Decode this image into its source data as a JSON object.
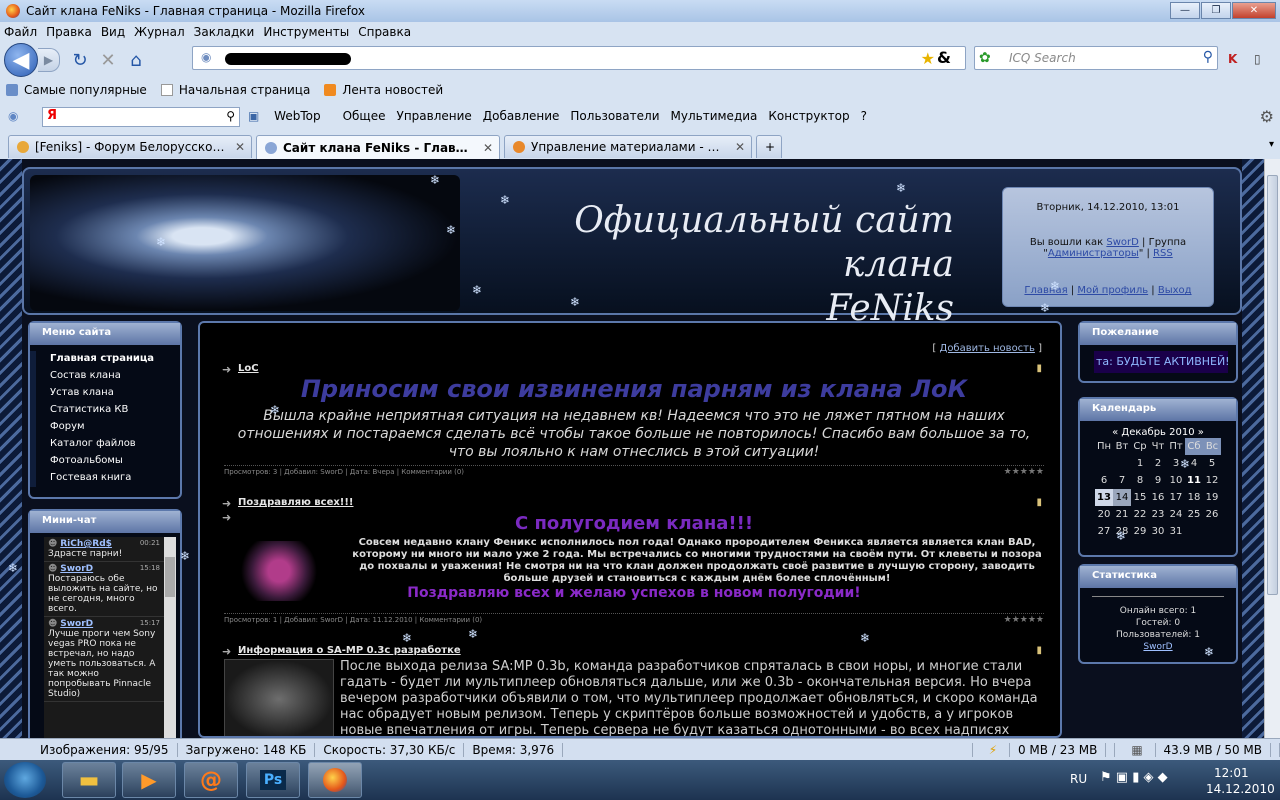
{
  "window": {
    "title": "Сайт клана FeNiks - Главная страница - Mozilla Firefox"
  },
  "menubar": [
    "Файл",
    "Правка",
    "Вид",
    "Журнал",
    "Закладки",
    "Инструменты",
    "Справка"
  ],
  "icq_search": {
    "placeholder": "ICQ Search"
  },
  "bookmarks": [
    "Самые популярные",
    "Начальная страница",
    "Лента новостей"
  ],
  "yandex": {
    "logo": "Я",
    "webtop": "WebTop",
    "menu": [
      "Общее",
      "Управление",
      "Добавление",
      "Пользователи",
      "Мультимедиа",
      "Конструктор",
      "?"
    ]
  },
  "tabs": [
    {
      "label": "[Feniks] - Форум Белорусского Иг..."
    },
    {
      "label": "Сайт клана FeNiks - Главная стра..."
    },
    {
      "label": "Управление материалами - Ново..."
    }
  ],
  "site": {
    "title_line1": "Официальный сайт клана",
    "title_line2": "FeNiks",
    "datetime": "Вторник, 14.12.2010, 13:01",
    "logged_in_prefix": "Вы вошли как",
    "username": "SworD",
    "group_prefix": "Группа",
    "group": "Администраторы",
    "rss": "RSS",
    "nav": [
      "Главная",
      "Мой профиль",
      "Выход"
    ],
    "site_menu_title": "Меню сайта",
    "site_menu": [
      "Главная страница",
      "Состав клана",
      "Устав клана",
      "Статистика КВ",
      "Форум",
      "Каталог файлов",
      "Фотоальбомы",
      "Гостевая книга"
    ],
    "minichat_title": "Мини-чат",
    "minichat": [
      {
        "name": "RiCh@Rd$",
        "time": "00:21",
        "text": "Здрасте парни!"
      },
      {
        "name": "SworD",
        "time": "15:18",
        "text": "Постараюсь обе выложить на сайте, но не сегодня, много всего."
      },
      {
        "name": "SworD",
        "time": "15:17",
        "text": "Лучше проги чем Sony vegas PRO пока не встречал, но надо уметь пользоваться. А так можно попробывать Pinnacle Studio)"
      }
    ],
    "add_news": "Добавить новость",
    "news": [
      {
        "title": "LoC",
        "headline": "Приносим свои извинения парням из клана ЛоК",
        "body": "Вышла крайне неприятная ситуация на недавнем кв! Надеемся что это не ляжет пятном на наших отношениях и постараемся сделать всё чтобы такое больше не повторилось! Спасибо вам большое за то, что вы лояльно к нам отнеслись в этой ситуации!",
        "meta": "Просмотров: 3 | Добавил: SworD | Дата: Вчера | Комментарии (0)"
      },
      {
        "title": "Поздравляю всех!!!",
        "headline": "С полугодием клана!!!",
        "body": "Совсем недавно клану Феникс исполнилось пол года! Однако прородителем Феникса является является клан BAD, которому ни много ни мало уже 2 года. Мы встречались со многими трудностями на своём пути. От клеветы и позора до похвалы и уважения! Не смотря ни на что клан должен продолжать своё развитие в лучшую сторону, заводить больше друзей и становиться с каждым днём более сплочённым!",
        "footer": "Поздравляю всех и желаю успехов в новом полугодии!",
        "meta": "Просмотров: 1 | Добавил: SworD | Дата: 11.12.2010 | Комментарии (0)"
      },
      {
        "title": "Информация о SA-MP 0.3c разработке",
        "body": "После выхода релиза SA:MP 0.3b, команда разработчиков спряталась в свои норы, и многие стали гадать - будет ли мультиплеер обновляться дальше, или же 0.3b - окончательная версия. Но вчера вечером разработчики объявили о том, что мультиплеер продолжает обновляться, и скоро команда нас обрадует новым релизом. Теперь у скриптёров больше возможностей и удобств, а у игроков новые впечатления от игры. Теперь сервера не будут казаться однотонными - во всех надписях"
      }
    ],
    "wish_title": "Пожелание",
    "wish_text": "та: БУДЬТЕ АКТИВНЕЙ!!",
    "calendar_title": "Календарь",
    "calendar_month": "« Декабрь 2010 »",
    "calendar_days": [
      "Пн",
      "Вт",
      "Ср",
      "Чт",
      "Пт",
      "Сб",
      "Вс"
    ],
    "calendar_rows": [
      [
        "",
        "",
        "1",
        "2",
        "3",
        "4",
        "5"
      ],
      [
        "6",
        "7",
        "8",
        "9",
        "10",
        "11",
        "12"
      ],
      [
        "13",
        "14",
        "15",
        "16",
        "17",
        "18",
        "19"
      ],
      [
        "20",
        "21",
        "22",
        "23",
        "24",
        "25",
        "26"
      ],
      [
        "27",
        "28",
        "29",
        "30",
        "31",
        "",
        ""
      ]
    ],
    "stats_title": "Статистика",
    "stats": {
      "online": "Онлайн всего: 1",
      "guests": "Гостей: 0",
      "users": "Пользователей: 1",
      "user": "SworD"
    }
  },
  "status": {
    "images": "Изображения: 95/95",
    "loaded": "Загружено: 148 КБ",
    "speed": "Скорость: 37,30 КБ/с",
    "time": "Время: 3,976",
    "mem1": "0 MB / 23 MB",
    "mem2": "43.9 MB / 50 MB"
  },
  "taskbar": {
    "lang": "RU",
    "clock": "12:01",
    "date": "14.12.2010"
  }
}
